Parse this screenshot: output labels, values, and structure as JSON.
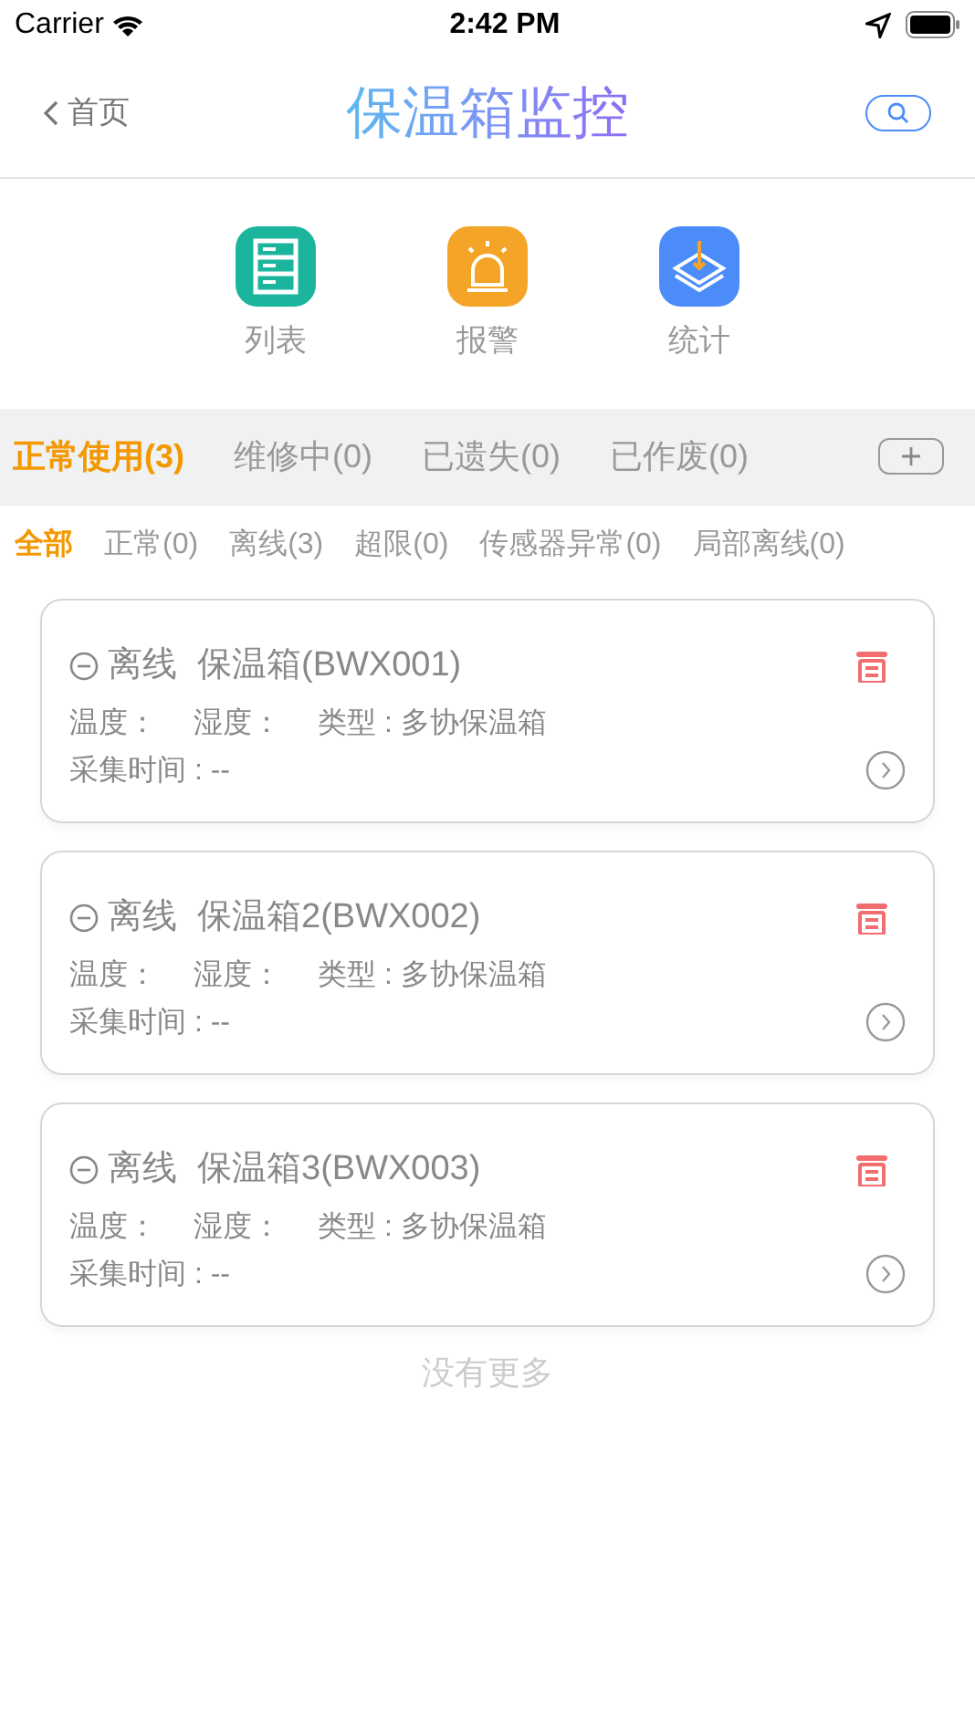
{
  "status_bar": {
    "carrier": "Carrier",
    "time": "2:42 PM"
  },
  "nav": {
    "back": "首页",
    "title": "保温箱监控"
  },
  "shortcuts": [
    {
      "kind": "list",
      "label": "列表"
    },
    {
      "kind": "alarm",
      "label": "报警"
    },
    {
      "kind": "stats",
      "label": "统计"
    }
  ],
  "tabs": [
    {
      "label": "正常使用(3)",
      "selected": true
    },
    {
      "label": "维修中(0)",
      "selected": false
    },
    {
      "label": "已遗失(0)",
      "selected": false
    },
    {
      "label": "已作废(0)",
      "selected": false
    }
  ],
  "filters": [
    {
      "label": "全部",
      "selected": true
    },
    {
      "label": "正常(0)",
      "selected": false
    },
    {
      "label": "离线(3)",
      "selected": false
    },
    {
      "label": "超限(0)",
      "selected": false
    },
    {
      "label": "传感器异常(0)",
      "selected": false
    },
    {
      "label": "局部离线(0)",
      "selected": false
    }
  ],
  "devices": [
    {
      "status": "离线",
      "name": "保温箱(BWX001)",
      "temperature": "温度：",
      "humidity": "湿度：",
      "type": "类型 : 多协保温箱",
      "time": "采集时间 : --"
    },
    {
      "status": "离线",
      "name": "保温箱2(BWX002)",
      "temperature": "温度：",
      "humidity": "湿度：",
      "type": "类型 : 多协保温箱",
      "time": "采集时间 : --"
    },
    {
      "status": "离线",
      "name": "保温箱3(BWX003)",
      "temperature": "温度：",
      "humidity": "湿度：",
      "type": "类型 : 多协保温箱",
      "time": "采集时间 : --"
    }
  ],
  "footer": "没有更多"
}
